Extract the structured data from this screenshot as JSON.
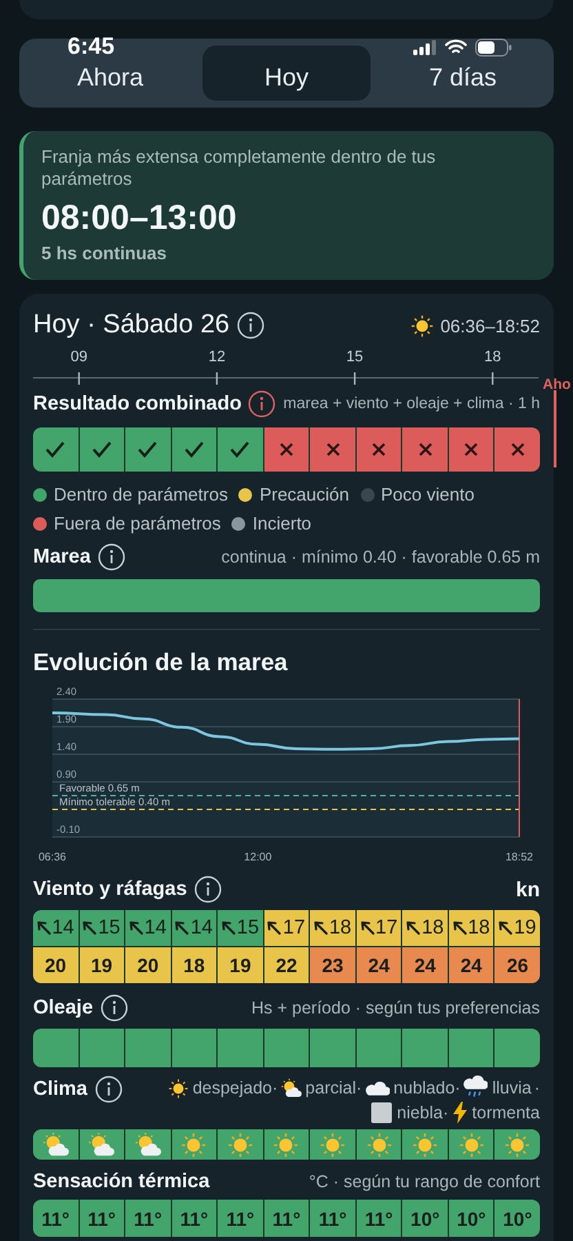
{
  "status_bar": {
    "time": "6:45"
  },
  "tabs": [
    {
      "label": "Ahora",
      "selected": false
    },
    {
      "label": "Hoy",
      "selected": true
    },
    {
      "label": "7 días",
      "selected": false
    }
  ],
  "best_window": {
    "description": "Franja más extensa completamente dentro de tus parámetros",
    "range": "08:00–13:00",
    "duration": "5 hs continuas"
  },
  "day": {
    "title": "Hoy · Sábado 26",
    "daylight": "06:36–18:52",
    "hour_ticks": [
      "09",
      "12",
      "15",
      "18"
    ],
    "now_label": "Aho"
  },
  "combined": {
    "title": "Resultado combinado",
    "note": "marea + viento + oleaje + clima · 1 h",
    "cells": [
      {
        "ok": true
      },
      {
        "ok": true
      },
      {
        "ok": true
      },
      {
        "ok": true
      },
      {
        "ok": true
      },
      {
        "ok": false
      },
      {
        "ok": false
      },
      {
        "ok": false
      },
      {
        "ok": false
      },
      {
        "ok": false
      },
      {
        "ok": false
      }
    ]
  },
  "legend": {
    "items": [
      {
        "label": "Dentro de parámetros",
        "color": "#3fa66a"
      },
      {
        "label": "Precaución",
        "color": "#e8c54a"
      },
      {
        "label": "Poco viento",
        "color": "#3b4750"
      },
      {
        "label": "Fuera de parámetros",
        "color": "#dc5c5c"
      },
      {
        "label": "Incierto",
        "color": "#8a959c"
      }
    ]
  },
  "tide": {
    "title": "Marea",
    "note": "continua · mínimo 0.40 · favorable 0.65 m",
    "ok": true
  },
  "tide_chart": {
    "title": "Evolución de la marea",
    "chart_data": {
      "type": "line",
      "x": [
        6.6,
        8,
        9,
        10,
        11,
        12,
        13,
        14,
        15,
        16,
        17,
        18,
        18.87
      ],
      "series": [
        {
          "color": "#7cc6e0",
          "values": [
            2.15,
            2.12,
            2.04,
            1.89,
            1.72,
            1.58,
            1.5,
            1.49,
            1.5,
            1.56,
            1.63,
            1.67,
            1.68
          ]
        }
      ],
      "xlim": [
        6.6,
        18.87
      ],
      "ylim": [
        -0.1,
        2.4
      ],
      "xticks": [
        {
          "value": 6.6,
          "label": "06:36"
        },
        {
          "value": 12,
          "label": "12:00"
        },
        {
          "value": 18.87,
          "label": "18:52"
        }
      ],
      "yticks": [
        {
          "value": 2.4,
          "label": "2.40"
        },
        {
          "value": 1.9,
          "label": "1.90"
        },
        {
          "value": 1.4,
          "label": "1.40"
        },
        {
          "value": 0.9,
          "label": "0.90"
        },
        {
          "value": -0.1,
          "label": "-0.10"
        }
      ],
      "grid": true,
      "ref_lines": [
        {
          "axis": "y",
          "value": 0.65,
          "label": "Favorable 0.65 m",
          "color": "#4fb3a0"
        },
        {
          "axis": "y",
          "value": 0.4,
          "label": "Mínimo tolerable 0.40 m",
          "color": "#e8c54a"
        },
        {
          "axis": "x",
          "value": 18.87,
          "color": "#dc5c5c"
        }
      ]
    }
  },
  "wind": {
    "title": "Viento y ráfagas",
    "unit": "kn",
    "speeds": [
      {
        "value": "14",
        "color": "#43a56b"
      },
      {
        "value": "15",
        "color": "#43a56b"
      },
      {
        "value": "14",
        "color": "#43a56b"
      },
      {
        "value": "14",
        "color": "#43a56b"
      },
      {
        "value": "15",
        "color": "#43a56b"
      },
      {
        "value": "17",
        "color": "#e8c54a"
      },
      {
        "value": "18",
        "color": "#e8c54a"
      },
      {
        "value": "17",
        "color": "#e8c54a"
      },
      {
        "value": "18",
        "color": "#e8c54a"
      },
      {
        "value": "18",
        "color": "#e8c54a"
      },
      {
        "value": "19",
        "color": "#e8c54a"
      }
    ],
    "gusts": [
      {
        "value": "20",
        "color": "#e8c54a"
      },
      {
        "value": "19",
        "color": "#e8c54a"
      },
      {
        "value": "20",
        "color": "#e8c54a"
      },
      {
        "value": "18",
        "color": "#e8c54a"
      },
      {
        "value": "19",
        "color": "#e8c54a"
      },
      {
        "value": "22",
        "color": "#e8c54a"
      },
      {
        "value": "23",
        "color": "#e8894f"
      },
      {
        "value": "24",
        "color": "#e8894f"
      },
      {
        "value": "24",
        "color": "#e8894f"
      },
      {
        "value": "24",
        "color": "#e8894f"
      },
      {
        "value": "26",
        "color": "#e8894f"
      }
    ]
  },
  "waves": {
    "title": "Oleaje",
    "note": "Hs + período · según tus preferencias",
    "cells": [
      {
        "ok": true
      },
      {
        "ok": true
      },
      {
        "ok": true
      },
      {
        "ok": true
      },
      {
        "ok": true
      },
      {
        "ok": true
      },
      {
        "ok": true
      },
      {
        "ok": true
      },
      {
        "ok": true
      },
      {
        "ok": true
      },
      {
        "ok": true
      }
    ]
  },
  "weather": {
    "title": "Clima",
    "legend": [
      {
        "kind": "sun",
        "label": "despejado·"
      },
      {
        "kind": "partly",
        "label": "parcial·"
      },
      {
        "kind": "cloud",
        "label": "nublado·"
      },
      {
        "kind": "rain",
        "label": "lluvia"
      },
      {
        "kind": "sep",
        "label": "·"
      },
      {
        "kind": "fog",
        "label": "niebla·"
      },
      {
        "kind": "storm",
        "label": "tormenta"
      }
    ],
    "cells": [
      {
        "kind": "partly"
      },
      {
        "kind": "partly"
      },
      {
        "kind": "partly"
      },
      {
        "kind": "sun"
      },
      {
        "kind": "sun"
      },
      {
        "kind": "sun"
      },
      {
        "kind": "sun"
      },
      {
        "kind": "sun"
      },
      {
        "kind": "sun"
      },
      {
        "kind": "sun"
      },
      {
        "kind": "sun"
      }
    ]
  },
  "feels": {
    "title": "Sensación térmica",
    "note": "°C · según tu rango de confort",
    "cells": [
      {
        "value": "11°",
        "ok": true
      },
      {
        "value": "11°",
        "ok": true
      },
      {
        "value": "11°",
        "ok": true
      },
      {
        "value": "11°",
        "ok": true
      },
      {
        "value": "11°",
        "ok": true
      },
      {
        "value": "11°",
        "ok": true
      },
      {
        "value": "11°",
        "ok": true
      },
      {
        "value": "11°",
        "ok": true
      },
      {
        "value": "10°",
        "ok": true
      },
      {
        "value": "10°",
        "ok": true
      },
      {
        "value": "10°",
        "ok": true
      }
    ]
  }
}
